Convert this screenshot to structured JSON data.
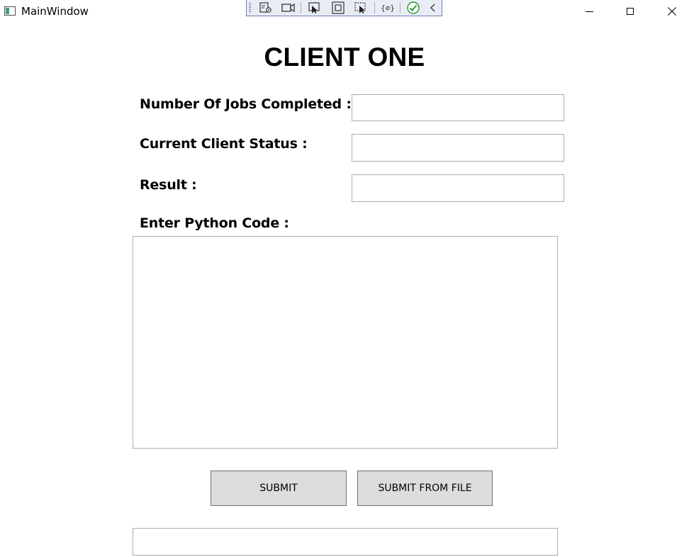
{
  "window": {
    "title": "MainWindow",
    "icons": {
      "app": "app-window-icon",
      "minimize": "minimize-icon",
      "maximize": "maximize-icon",
      "close": "close-icon"
    }
  },
  "debug_toolbar": {
    "icons": [
      "live-visual-tree-icon",
      "video-camera-icon",
      "select-element-icon",
      "display-layout-adorners-icon",
      "track-focus-icon",
      "binding-failures-icon",
      "hot-reload-check-icon",
      "collapse-chevron-icon"
    ]
  },
  "main": {
    "heading": "CLIENT ONE",
    "fields": {
      "jobs_completed": {
        "label": "Number Of Jobs Completed :",
        "value": "",
        "placeholder": ""
      },
      "client_status": {
        "label": "Current Client Status :",
        "value": "",
        "placeholder": ""
      },
      "result": {
        "label": "Result :",
        "value": "",
        "placeholder": ""
      }
    },
    "code": {
      "label": "Enter Python Code :",
      "value": "",
      "placeholder": ""
    },
    "buttons": {
      "submit": "SUBMIT",
      "submit_from_file": "SUBMIT FROM FILE"
    },
    "status": {
      "value": "",
      "placeholder": ""
    }
  },
  "colors": {
    "button_bg": "#dddddd",
    "button_border": "#707070",
    "textbox_border": "#abadb3",
    "toolbar_bg": "#e9ecf5",
    "toolbar_border": "#6b7fb3",
    "check_green": "#2a9a2a"
  }
}
